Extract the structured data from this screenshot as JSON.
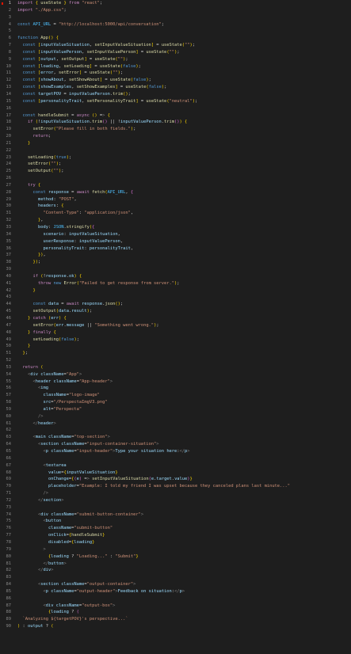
{
  "editor": {
    "lines": [
      {
        "n": "1",
        "t": "import { useState } from \"react\";"
      },
      {
        "n": "2",
        "t": "import \"./App.css\";"
      },
      {
        "n": "3",
        "t": ""
      },
      {
        "n": "4",
        "t": "const API_URL = \"http://localhost:5000/api/conversation\";"
      },
      {
        "n": "5",
        "t": ""
      },
      {
        "n": "6",
        "t": "function App() {"
      },
      {
        "n": "7",
        "t": "  const [inputValueSituation, setInputValueSituation] = useState(\"\");"
      },
      {
        "n": "8",
        "t": "  const [inputValuePerson, setInputValuePerson] = useState(\"\");"
      },
      {
        "n": "9",
        "t": "  const [output, setOutput] = useState(\"\");"
      },
      {
        "n": "10",
        "t": "  const [loading, setLoading] = useState(false);"
      },
      {
        "n": "11",
        "t": "  const [error, setError] = useState(\"\");"
      },
      {
        "n": "12",
        "t": "  const [showAbout, setShowAbout] = useState(false);"
      },
      {
        "n": "13",
        "t": "  const [showExamples, setShowExamples] = useState(false);"
      },
      {
        "n": "14",
        "t": "  const targetPOV = inputValuePerson.trim();"
      },
      {
        "n": "15",
        "t": "  const [personalityTrait, setPersonalityTrait] = useState(\"neutral\");"
      },
      {
        "n": "16",
        "t": ""
      },
      {
        "n": "17",
        "t": "  const handleSubmit = async () => {"
      },
      {
        "n": "18",
        "t": "    if (!inputValueSituation.trim() || !inputValuePerson.trim()) {"
      },
      {
        "n": "19",
        "t": "      setError(\"Please fill in both fields.\");"
      },
      {
        "n": "20",
        "t": "      return;"
      },
      {
        "n": "21",
        "t": "    }"
      },
      {
        "n": "22",
        "t": ""
      },
      {
        "n": "23",
        "t": "    setLoading(true);"
      },
      {
        "n": "24",
        "t": "    setError(\"\");"
      },
      {
        "n": "25",
        "t": "    setOutput(\"\");"
      },
      {
        "n": "26",
        "t": ""
      },
      {
        "n": "27",
        "t": "    try {"
      },
      {
        "n": "28",
        "t": "      const response = await fetch(API_URL, {"
      },
      {
        "n": "29",
        "t": "        method: \"POST\","
      },
      {
        "n": "30",
        "t": "        headers: {"
      },
      {
        "n": "31",
        "t": "          \"Content-Type\": \"application/json\","
      },
      {
        "n": "32",
        "t": "        },"
      },
      {
        "n": "33",
        "t": "        body: JSON.stringify({"
      },
      {
        "n": "34",
        "t": "          scenario: inputValueSituation,"
      },
      {
        "n": "35",
        "t": "          userResponse: inputValuePerson,"
      },
      {
        "n": "36",
        "t": "          personalityTrait: personalityTrait,"
      },
      {
        "n": "37",
        "t": "        }),"
      },
      {
        "n": "38",
        "t": "      });"
      },
      {
        "n": "39",
        "t": ""
      },
      {
        "n": "40",
        "t": "      if (!response.ok) {"
      },
      {
        "n": "41",
        "t": "        throw new Error(\"Failed to get response from server.\");"
      },
      {
        "n": "42",
        "t": "      }"
      },
      {
        "n": "43",
        "t": ""
      },
      {
        "n": "44",
        "t": "      const data = await response.json();"
      },
      {
        "n": "45",
        "t": "      setOutput(data.result);"
      },
      {
        "n": "46",
        "t": "    } catch (err) {"
      },
      {
        "n": "47",
        "t": "      setError(err.message || \"Something went wrong.\");"
      },
      {
        "n": "48",
        "t": "    } finally {"
      },
      {
        "n": "49",
        "t": "      setLoading(false);"
      },
      {
        "n": "50",
        "t": "    }"
      },
      {
        "n": "51",
        "t": "  };"
      },
      {
        "n": "52",
        "t": ""
      },
      {
        "n": "53",
        "t": "  return ("
      },
      {
        "n": "54",
        "t": "    <div className=\"App\">"
      },
      {
        "n": "55",
        "t": "      <header className=\"App-header\">"
      },
      {
        "n": "56",
        "t": "        <img"
      },
      {
        "n": "57",
        "t": "          className=\"logo-image\""
      },
      {
        "n": "58",
        "t": "          src=\"/PerspectaImgV3.png\""
      },
      {
        "n": "59",
        "t": "          alt=\"Perspecta\""
      },
      {
        "n": "60",
        "t": "        />"
      },
      {
        "n": "61",
        "t": "      </header>"
      },
      {
        "n": "62",
        "t": ""
      },
      {
        "n": "63",
        "t": "      <main className=\"top-section\">"
      },
      {
        "n": "64",
        "t": "        <section className=\"input-container-situation\">"
      },
      {
        "n": "65",
        "t": "          <p className=\"input-header\">Type your situation here:</p>"
      },
      {
        "n": "66",
        "t": ""
      },
      {
        "n": "67",
        "t": "          <textarea"
      },
      {
        "n": "68",
        "t": "            value={inputValueSituation}"
      },
      {
        "n": "69",
        "t": "            onChange={(e) => setInputValueSituation(e.target.value)}"
      },
      {
        "n": "70",
        "t": "            placeholder=\"Example: I told my friend I was upset because they canceled plans last minute...\""
      },
      {
        "n": "71",
        "t": "          />"
      },
      {
        "n": "72",
        "t": "        </section>"
      },
      {
        "n": "73",
        "t": ""
      },
      {
        "n": "74",
        "t": "        <div className=\"submit-button-container\">"
      },
      {
        "n": "75",
        "t": "          <button"
      },
      {
        "n": "76",
        "t": "            className=\"submit-button\""
      },
      {
        "n": "77",
        "t": "            onClick={handleSubmit}"
      },
      {
        "n": "78",
        "t": "            disabled={loading}"
      },
      {
        "n": "79",
        "t": "          >"
      },
      {
        "n": "80",
        "t": "            {loading ? \"Loading...\" : \"Submit\"}"
      },
      {
        "n": "81",
        "t": "          </button>"
      },
      {
        "n": "82",
        "t": "        </div>"
      },
      {
        "n": "83",
        "t": ""
      },
      {
        "n": "84",
        "t": "        <section className=\"output-container\">"
      },
      {
        "n": "85",
        "t": "          <p className=\"output-header\">Feedback on situation:</p>"
      },
      {
        "n": "86",
        "t": ""
      },
      {
        "n": "87",
        "t": "          <div className=\"output-box\">"
      },
      {
        "n": "88",
        "t": "            {loading ? ("
      },
      {
        "n": "89",
        "t": "  `Analyzing ${targetPOV}'s perspective...`"
      },
      {
        "n": "90",
        "t": ") : output ? ("
      }
    ],
    "active_line": "1",
    "colors": {
      "background": "#1e1e1e",
      "keyword": "#c586c0",
      "declaration": "#569cd6",
      "string": "#ce9178",
      "function": "#dcdcaa",
      "variable": "#9cdcfe",
      "line_number": "#858585"
    }
  }
}
